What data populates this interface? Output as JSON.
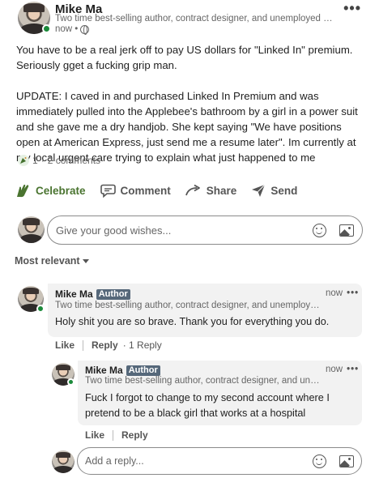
{
  "post": {
    "author_name": "Mike Ma",
    "headline": "Two time best-selling author, contract designer, and unemployed fel...",
    "time": "now •",
    "body": [
      "You have to be a real jerk off to pay US dollars for \"Linked In\" premium. Seriously gget a fucking grip man.",
      "UPDATE: I caved in and purchased Linked In Premium and was immediately pulled into the Applebee's bathroom by a girl in a power suit and she gave me a dry handjob. She kept saying \"We have positions open at American Express, just send me a resume later\". Im currently at my local urgent care trying to explain what just happened to me"
    ],
    "reactions_count": "1",
    "comments_count": "2 comments",
    "icons": {
      "reaction": "celebrate-icon",
      "visibility": "globe-icon",
      "menu": "more-icon"
    }
  },
  "actions": {
    "celebrate": "Celebrate",
    "comment": "Comment",
    "share": "Share",
    "send": "Send"
  },
  "comment_box": {
    "placeholder": "Give your good wishes..."
  },
  "sort_label": "Most relevant",
  "comments": [
    {
      "name": "Mike Ma",
      "badge": "Author",
      "headline": "Two time best-selling author, contract designer, and unemploye...",
      "time": "now",
      "text": "Holy shit you are so brave. Thank you for everything you do.",
      "like": "Like",
      "reply": "Reply",
      "reply_count": "· 1 Reply"
    },
    {
      "name": "Mike Ma",
      "badge": "Author",
      "headline": "Two time best-selling author, contract designer, and une...",
      "time": "now",
      "text": "Fuck I forgot to change to my second account where I pretend to be a black girl that works at a hospital",
      "like": "Like",
      "reply": "Reply"
    }
  ],
  "reply_box": {
    "placeholder": "Add a reply..."
  },
  "colors": {
    "celebrate": "#4a7430",
    "author_badge": "#56687a",
    "online": "#1b8a3a"
  }
}
